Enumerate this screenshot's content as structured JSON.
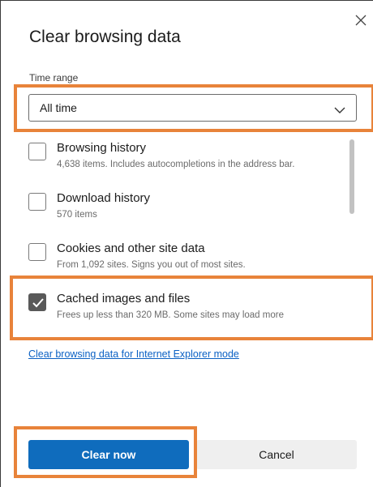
{
  "dialog": {
    "title": "Clear browsing data",
    "close_icon": "close-icon"
  },
  "time_range": {
    "label": "Time range",
    "selected": "All time",
    "chevron_icon": "chevron-down-icon"
  },
  "items": [
    {
      "title": "Browsing history",
      "description": "4,638 items. Includes autocompletions in the address bar.",
      "checked": false
    },
    {
      "title": "Download history",
      "description": "570 items",
      "checked": false
    },
    {
      "title": "Cookies and other site data",
      "description": "From 1,092 sites. Signs you out of most sites.",
      "checked": false
    },
    {
      "title": "Cached images and files",
      "description": "Frees up less than 320 MB. Some sites may load more",
      "checked": true
    }
  ],
  "ie_link": "Clear browsing data for Internet Explorer mode",
  "buttons": {
    "clear": "Clear now",
    "cancel": "Cancel"
  },
  "colors": {
    "accent": "#0f6cbd",
    "highlight": "#e8833a",
    "checkbox_checked": "#595959",
    "link": "#0b61c4"
  }
}
